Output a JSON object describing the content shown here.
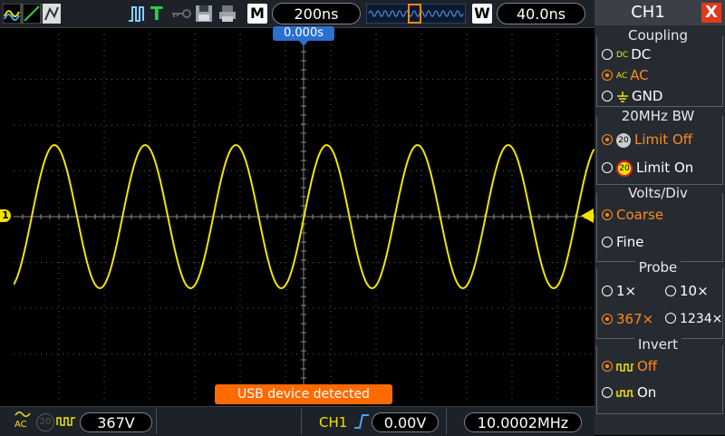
{
  "header": {
    "timebase": "200ns",
    "trigger_pos_label": "W",
    "mode_label": "M",
    "window_timebase": "40.0ns",
    "trigger_indicator": "T"
  },
  "screen": {
    "time_offset": "0.000s",
    "channel_marker": "1",
    "toast": "USB device detected"
  },
  "waveform": {
    "color": "#f2e400",
    "frequency_cycles_visible": 6.4
  },
  "footer": {
    "coupling_icon": "AC",
    "bw_icon": "20",
    "volts_div": "367V",
    "trigger_source": "CH1",
    "trigger_level": "0.00V",
    "frequency": "10.0002MHz"
  },
  "panel": {
    "title": "CH1",
    "close": "X",
    "coupling": {
      "title": "Coupling",
      "options": [
        {
          "icon": "DC",
          "label": "DC",
          "selected": false
        },
        {
          "icon": "AC",
          "label": "AC",
          "selected": true
        },
        {
          "icon": "GND",
          "label": "GND",
          "selected": false
        }
      ]
    },
    "bw": {
      "title": "20MHz BW",
      "options": [
        {
          "icon": "20",
          "label": "Limit Off",
          "selected": true
        },
        {
          "icon": "20",
          "label": "Limit On",
          "selected": false
        }
      ]
    },
    "volts": {
      "title": "Volts/Div",
      "options": [
        {
          "label": "Coarse",
          "selected": true
        },
        {
          "label": "Fine",
          "selected": false
        }
      ]
    },
    "probe": {
      "title": "Probe",
      "options": [
        {
          "label": "1×",
          "selected": false
        },
        {
          "label": "10×",
          "selected": false
        },
        {
          "label": "367×",
          "selected": true
        },
        {
          "label": "1234×",
          "selected": false
        }
      ]
    },
    "invert": {
      "title": "Invert",
      "options": [
        {
          "label": "Off",
          "selected": true
        },
        {
          "label": "On",
          "selected": false
        }
      ]
    }
  }
}
